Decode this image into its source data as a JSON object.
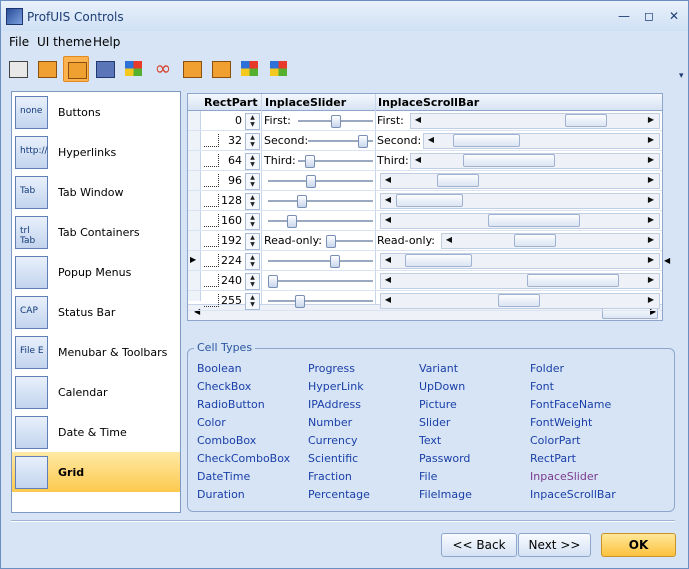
{
  "window": {
    "title": "ProfUIS Controls"
  },
  "menu": [
    "File",
    "UI theme",
    "Help"
  ],
  "toolbar": {
    "buttons": [
      {
        "icon": "theme-2000-icon",
        "style": "plain"
      },
      {
        "icon": "theme-xp-icon",
        "style": "orange"
      },
      {
        "icon": "theme-2003-icon",
        "style": "orange",
        "active": true
      },
      {
        "icon": "theme-2005-icon",
        "style": "blue"
      },
      {
        "icon": "windows-xp-icon",
        "style": "win"
      },
      {
        "icon": "infinity-icon",
        "style": "inf"
      },
      {
        "icon": "theme-2007-icon",
        "style": "orange"
      },
      {
        "icon": "theme-2010-icon",
        "style": "orange"
      },
      {
        "icon": "puzzle-icon",
        "style": "win"
      },
      {
        "icon": "windows-flag-icon",
        "style": "win"
      }
    ]
  },
  "nav": {
    "items": [
      {
        "label": "Buttons",
        "thumb": "none"
      },
      {
        "label": "Hyperlinks",
        "thumb": "http://"
      },
      {
        "label": "Tab Window",
        "thumb": "Tab"
      },
      {
        "label": "Tab Containers",
        "thumb": "trl Tab"
      },
      {
        "label": "Popup Menus",
        "thumb": ""
      },
      {
        "label": "Status Bar",
        "thumb": "CAP"
      },
      {
        "label": "Menubar & Toolbars",
        "thumb": "File E"
      },
      {
        "label": "Calendar",
        "thumb": ""
      },
      {
        "label": "Date & Time",
        "thumb": ""
      },
      {
        "label": "Grid",
        "thumb": "",
        "active": true
      }
    ]
  },
  "grid": {
    "columns": [
      "RectPart",
      "InplaceSlider",
      "InplaceScrollBar"
    ],
    "rows": [
      {
        "value": "0",
        "slider_label": "First:",
        "slider": 0.5,
        "scroll_label": "First:",
        "scroll": 0.8
      },
      {
        "value": "32",
        "slider_label": "Second:",
        "slider": 0.9,
        "scroll_label": "Second:",
        "scroll": 0.1
      },
      {
        "value": "64",
        "slider_label": "Third:",
        "slider": 0.1,
        "scroll_label": "Third:",
        "scroll": 0.3
      },
      {
        "value": "96",
        "slider_label": "",
        "slider": 0.4,
        "scroll_label": "",
        "scroll": 0.2
      },
      {
        "value": "128",
        "slider_label": "",
        "slider": 0.3,
        "scroll_label": "",
        "scroll": 0.0
      },
      {
        "value": "160",
        "slider_label": "",
        "slider": 0.2,
        "scroll_label": "",
        "scroll": 0.6
      },
      {
        "value": "192",
        "slider_label": "Read-only:",
        "slider": 0.0,
        "scroll_label": "Read-only:",
        "scroll": 0.4
      },
      {
        "value": "224",
        "slider_label": "",
        "slider": 0.65,
        "scroll_label": "",
        "scroll": 0.05
      },
      {
        "value": "240",
        "slider_label": "",
        "slider": 0.0,
        "scroll_label": "",
        "scroll": 0.85
      },
      {
        "value": "255",
        "slider_label": "",
        "slider": 0.28,
        "scroll_label": "",
        "scroll": 0.5
      }
    ]
  },
  "cell_types": {
    "legend": "Cell Types",
    "columns": [
      [
        "Boolean",
        "CheckBox",
        "RadioButton",
        "Color",
        "ComboBox",
        "CheckComboBox",
        "DateTime",
        "Duration"
      ],
      [
        "Progress",
        "HyperLink",
        "IPAddress",
        "Number",
        "Currency",
        "Scientific",
        "Fraction",
        "Percentage"
      ],
      [
        "Variant",
        "UpDown",
        "Picture",
        "Slider",
        "Text",
        "Password",
        "File",
        "FileImage"
      ],
      [
        "Folder",
        "Font",
        "FontFaceName",
        "FontWeight",
        "ColorPart",
        "RectPart",
        "InpaceSlider",
        "InpaceScrollBar"
      ]
    ],
    "visited": "InpaceSlider"
  },
  "buttons": {
    "back": "<< Back",
    "next": "Next >>",
    "ok": "OK"
  }
}
